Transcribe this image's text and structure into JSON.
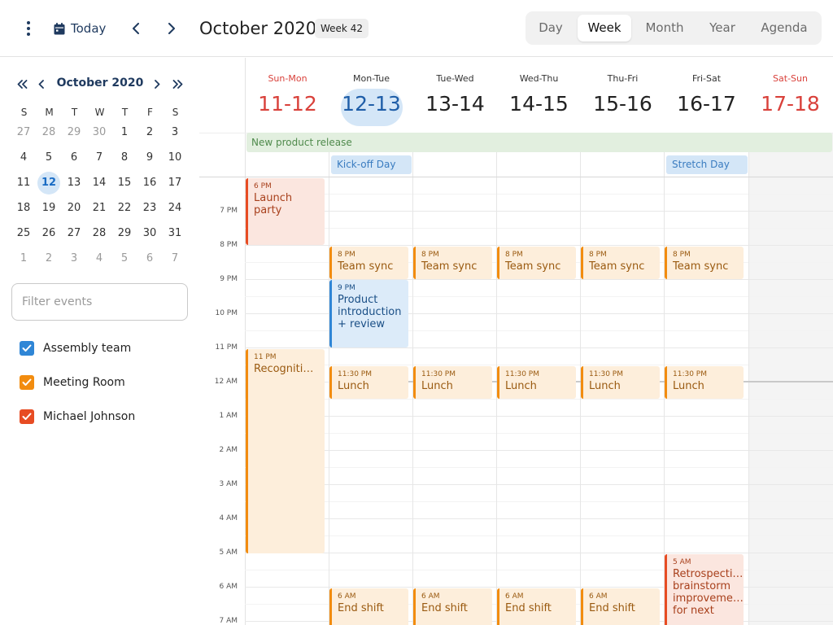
{
  "header": {
    "menu_icon": "more-vert-icon",
    "today_label": "Today",
    "today_icon": "calendar-icon",
    "prev_icon": "chevron-left-icon",
    "next_icon": "chevron-right-icon",
    "title": "October 2020",
    "week_badge": "Week 42",
    "views": [
      "Day",
      "Week",
      "Month",
      "Year",
      "Agenda"
    ],
    "active_view": "Week"
  },
  "mini_calendar": {
    "title": "October 2020",
    "weekdays": [
      "S",
      "M",
      "T",
      "W",
      "T",
      "F",
      "S"
    ],
    "weeks": [
      [
        "27",
        "28",
        "29",
        "30",
        "1",
        "2",
        "3"
      ],
      [
        "4",
        "5",
        "6",
        "7",
        "8",
        "9",
        "10"
      ],
      [
        "11",
        "12",
        "13",
        "14",
        "15",
        "16",
        "17"
      ],
      [
        "18",
        "19",
        "20",
        "21",
        "22",
        "23",
        "24"
      ],
      [
        "25",
        "26",
        "27",
        "28",
        "29",
        "30",
        "31"
      ],
      [
        "1",
        "2",
        "3",
        "4",
        "5",
        "6",
        "7"
      ]
    ],
    "selected_day": "12"
  },
  "filter": {
    "placeholder": "Filter events"
  },
  "resources": [
    {
      "label": "Assembly team",
      "color": "#2f86d6",
      "checked": true
    },
    {
      "label": "Meeting Room",
      "color": "#f28c0f",
      "checked": true
    },
    {
      "label": "Michael Johnson",
      "color": "#e74c23",
      "checked": true
    }
  ],
  "days": [
    {
      "name": "Sun-Mon",
      "dates": "11-12",
      "weekend": true
    },
    {
      "name": "Mon-Tue",
      "dates": "12-13",
      "today": true
    },
    {
      "name": "Tue-Wed",
      "dates": "13-14"
    },
    {
      "name": "Wed-Thu",
      "dates": "14-15"
    },
    {
      "name": "Thu-Fri",
      "dates": "15-16"
    },
    {
      "name": "Fri-Sat",
      "dates": "16-17"
    },
    {
      "name": "Sat-Sun",
      "dates": "17-18",
      "weekend": true
    }
  ],
  "all_day": {
    "banner": "New product release",
    "chips": [
      "Kick-off Day",
      "Stretch Day"
    ]
  },
  "hours": [
    "7 PM",
    "8 PM",
    "9 PM",
    "10 PM",
    "11 PM",
    "12 AM",
    "1 AM",
    "2 AM",
    "3 AM",
    "4 AM",
    "5 AM",
    "6 AM",
    "7 AM"
  ],
  "events": {
    "launch_party": {
      "time": "6 PM",
      "name": "Launch party"
    },
    "recognition": {
      "time": "11 PM",
      "name": "Recognitio…"
    },
    "product_intro": {
      "time": "9 PM",
      "name": "Product introduction + review"
    },
    "retro": {
      "time": "5 AM",
      "name": "Retrospecti… brainstorm improveme… for next"
    },
    "team_sync": [
      {
        "time": "8 PM",
        "name": "Team sync"
      },
      {
        "time": "8 PM",
        "name": "Team sync"
      },
      {
        "time": "8 PM",
        "name": "Team sync"
      },
      {
        "time": "8 PM",
        "name": "Team sync"
      },
      {
        "time": "8 PM",
        "name": "Team sync"
      }
    ],
    "lunch": [
      {
        "time": "11:30 PM",
        "name": "Lunch"
      },
      {
        "time": "11:30 PM",
        "name": "Lunch"
      },
      {
        "time": "11:30 PM",
        "name": "Lunch"
      },
      {
        "time": "11:30 PM",
        "name": "Lunch"
      },
      {
        "time": "11:30 PM",
        "name": "Lunch"
      }
    ],
    "end_shift": [
      {
        "time": "6 AM",
        "name": "End shift"
      },
      {
        "time": "6 AM",
        "name": "End shift"
      },
      {
        "time": "6 AM",
        "name": "End shift"
      },
      {
        "time": "6 AM",
        "name": "End shift"
      }
    ]
  }
}
